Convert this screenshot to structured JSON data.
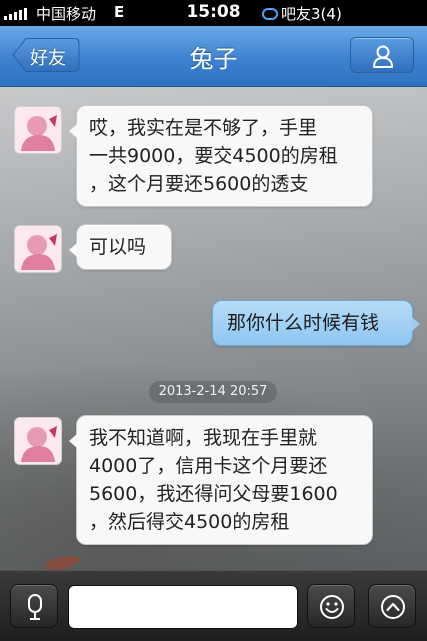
{
  "status_bar": {
    "carrier": "中国移动",
    "network": "E",
    "time": "15:08",
    "app_notice": "吧友3(4)"
  },
  "nav": {
    "back_label": "好友",
    "title": "兔子",
    "profile_icon": "person-icon"
  },
  "messages": [
    {
      "direction": "in",
      "lines": [
        "哎，我实在是不够了，手里",
        "一共9000，要交4500的房租",
        "，这个月要还5600的透支"
      ]
    },
    {
      "direction": "in",
      "lines": [
        "可以吗"
      ]
    },
    {
      "direction": "out",
      "lines": [
        "那你什么时候有钱"
      ]
    },
    {
      "direction": "in",
      "lines": [
        "我不知道啊，我现在手里就",
        "4000了，信用卡这个月要还",
        "5600，我还得问父母要1600",
        "，然后得交4500的房租"
      ]
    }
  ],
  "timestamp": "2013-2-14 20:57",
  "input_bar": {
    "voice_icon": "microphone-icon",
    "text_value": "",
    "emoji_icon": "smiley-icon",
    "more_icon": "chevron-up-icon"
  },
  "colors": {
    "nav_blue": "#3d82cf",
    "outgoing_bubble": "#8fc6f1",
    "incoming_bubble": "#f8f8f8"
  }
}
